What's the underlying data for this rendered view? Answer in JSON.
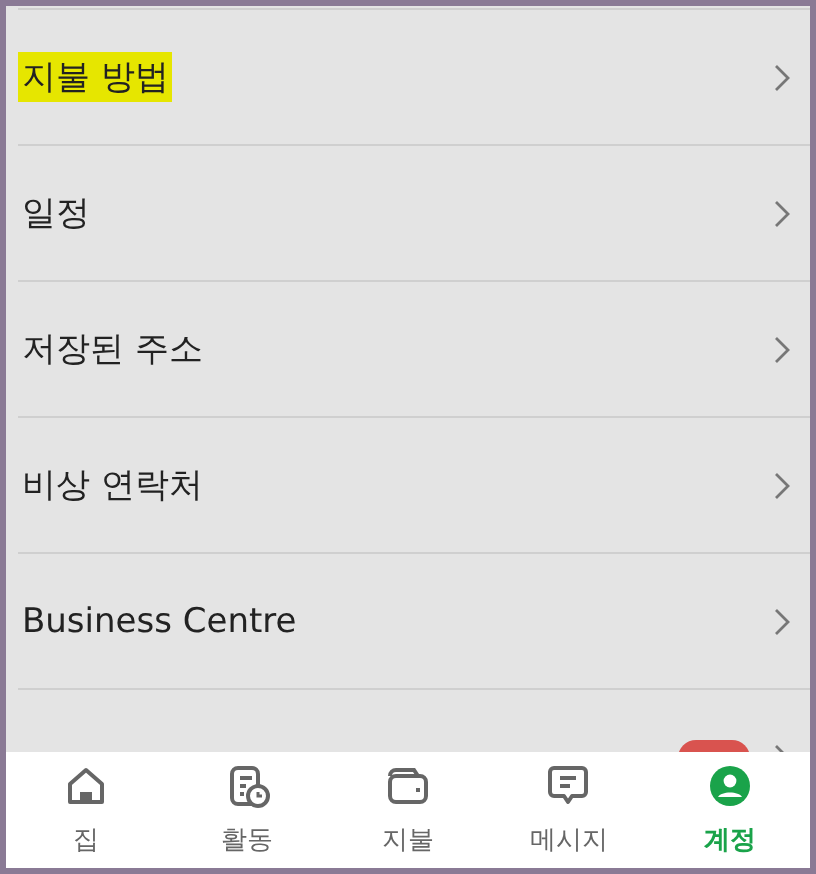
{
  "menu_items": [
    {
      "label": "지불 방법",
      "highlighted": true
    },
    {
      "label": "일정",
      "highlighted": false
    },
    {
      "label": "저장된 주소",
      "highlighted": false
    },
    {
      "label": "비상 연락처",
      "highlighted": false
    },
    {
      "label": "Business Centre",
      "highlighted": false
    },
    {
      "highlighted": false,
      "badge": true
    }
  ],
  "bottom_nav": [
    {
      "label": "집",
      "kind": "home",
      "selected": false
    },
    {
      "label": "활동",
      "kind": "activity",
      "selected": false
    },
    {
      "label": "지불",
      "kind": "wallet",
      "selected": false
    },
    {
      "label": "메시지",
      "kind": "message",
      "selected": false
    },
    {
      "label": "계정",
      "kind": "account",
      "selected": true
    }
  ]
}
